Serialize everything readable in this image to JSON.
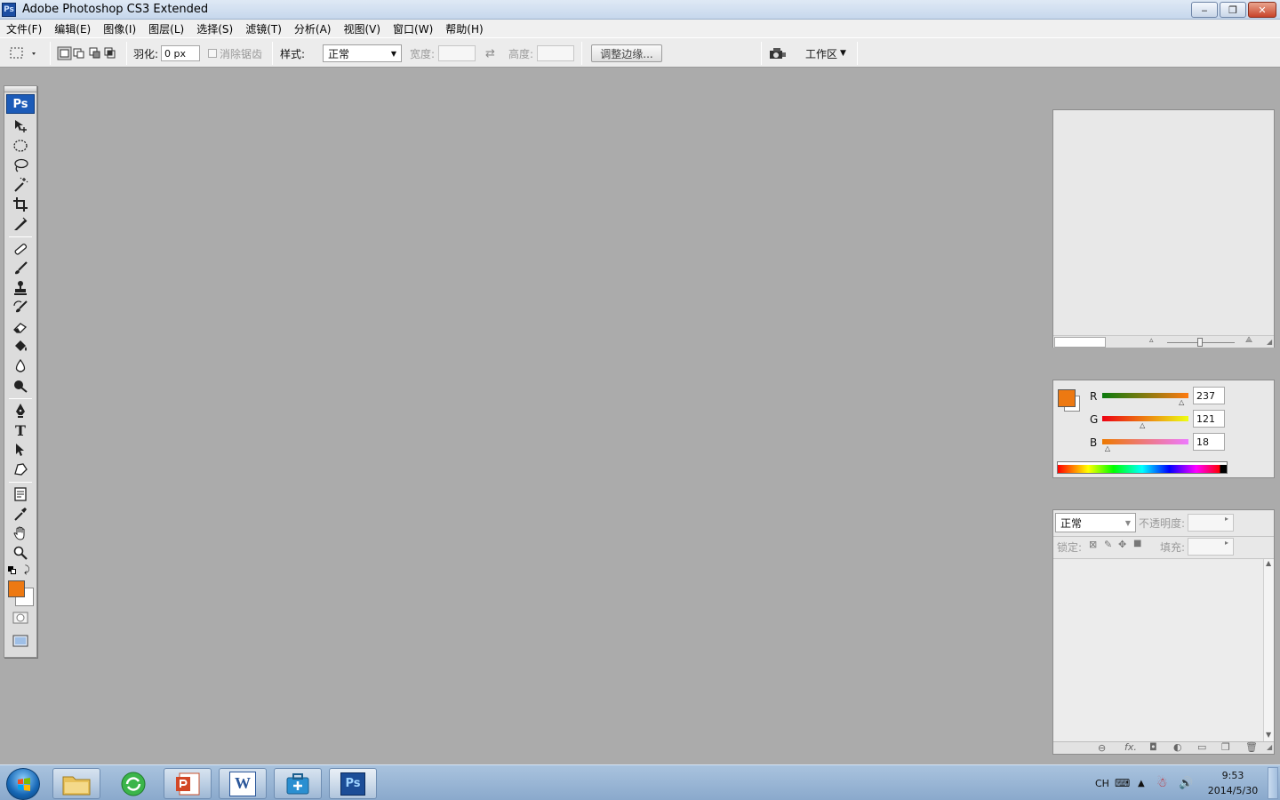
{
  "window": {
    "title": "Adobe Photoshop CS3 Extended",
    "app_icon": "Ps",
    "min_glyph": "‒",
    "max_glyph": "❐",
    "close_glyph": "✕"
  },
  "menu": [
    "文件(F)",
    "编辑(E)",
    "图像(I)",
    "图层(L)",
    "选择(S)",
    "滤镜(T)",
    "分析(A)",
    "视图(V)",
    "窗口(W)",
    "帮助(H)"
  ],
  "options": {
    "feather_label": "羽化:",
    "feather_value": "0 px",
    "antialias_label": "消除锯齿",
    "style_label": "样式:",
    "style_value": "正常",
    "width_label": "宽度:",
    "height_label": "高度:",
    "refine_edge_button": "调整边缘...",
    "workspace_button": "工作区"
  },
  "toolbox": {
    "logo": "Ps",
    "text_tool_glyph": "T"
  },
  "color_panel": {
    "foreground": "#ED7912",
    "background": "#FFFFFF",
    "channels": [
      {
        "label": "R",
        "value": "237",
        "fraction": 0.929
      },
      {
        "label": "G",
        "value": "121",
        "fraction": 0.475
      },
      {
        "label": "B",
        "value": "18",
        "fraction": 0.071
      }
    ]
  },
  "layers_panel": {
    "blend_mode": "正常",
    "opacity_label": "不透明度:",
    "lock_label": "锁定:",
    "fill_label": "填充:",
    "footer_fx": "fx."
  },
  "taskbar": {
    "apps": [
      "start-orb",
      "file-explorer",
      "360-browser",
      "powerpoint",
      "word",
      "app-5",
      "photoshop"
    ],
    "ps_label": "Ps",
    "word_label": "W",
    "ime": "CH",
    "time": "9:53",
    "date": "2014/5/30"
  },
  "colors": {
    "canvas_bg": "#ABABAB",
    "accent_ps": "#1C5BB8",
    "foreground_swatch": "#ED7912"
  }
}
